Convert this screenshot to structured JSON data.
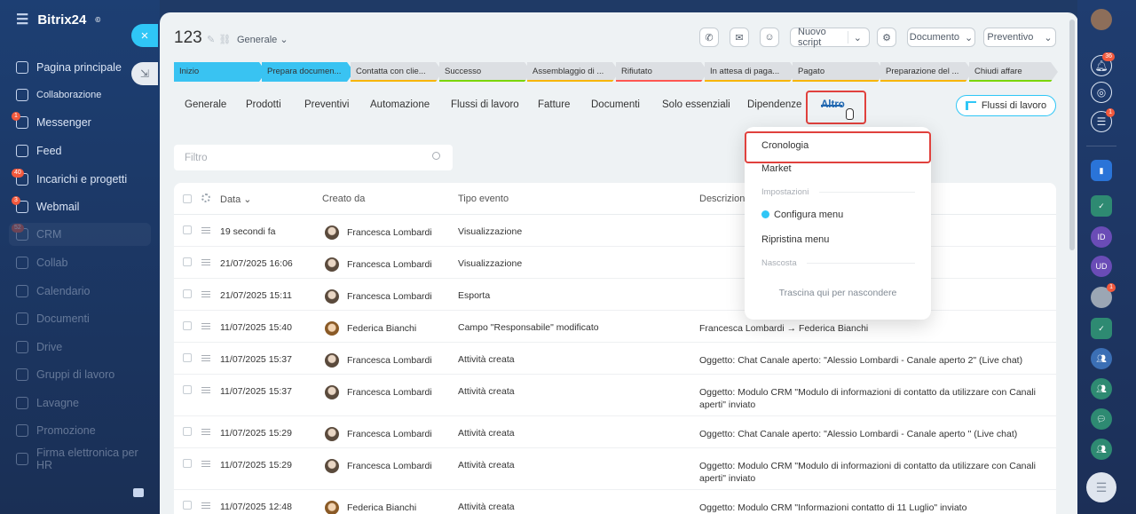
{
  "sidebar": {
    "brand": "Bitrix24",
    "brand_sup": "©",
    "items": [
      {
        "label": "Pagina principale",
        "badge": ""
      },
      {
        "label": "Collaborazione",
        "badge": ""
      },
      {
        "label": "Messenger",
        "badge": "1"
      },
      {
        "label": "Feed",
        "badge": ""
      },
      {
        "label": "Incarichi e progetti",
        "badge": "40"
      },
      {
        "label": "Webmail",
        "badge": "3"
      },
      {
        "label": "CRM",
        "badge": "52"
      },
      {
        "label": "Collab",
        "badge": ""
      },
      {
        "label": "Calendario",
        "badge": ""
      },
      {
        "label": "Documenti",
        "badge": ""
      },
      {
        "label": "Drive",
        "badge": ""
      },
      {
        "label": "Gruppi di lavoro",
        "badge": ""
      },
      {
        "label": "Lavagne",
        "badge": ""
      },
      {
        "label": "Promozione",
        "badge": ""
      },
      {
        "label": "Firma elettronica per HR",
        "badge": ""
      }
    ]
  },
  "panel": {
    "close_label": "×",
    "collapse_label": "⇲",
    "title": "123",
    "category": "Generale",
    "header_buttons": {
      "nuovo_script": "Nuovo script",
      "documento": "Documento",
      "preventivo": "Preventivo"
    },
    "stages": [
      {
        "label": "Inizio",
        "color": "#39c3f2"
      },
      {
        "label": "Prepara documen...",
        "color": "#39c3f2"
      },
      {
        "label": "Contatta con clie...",
        "color": "#dcdfe3"
      },
      {
        "label": "Successo",
        "color": "#dcdfe3"
      },
      {
        "label": "Assemblaggio di ...",
        "color": "#dcdfe3"
      },
      {
        "label": "Rifiutato",
        "color": "#dcdfe3"
      },
      {
        "label": "In attesa di paga...",
        "color": "#dcdfe3"
      },
      {
        "label": "Pagato",
        "color": "#dcdfe3"
      },
      {
        "label": "Preparazione del ...",
        "color": "#dcdfe3"
      },
      {
        "label": "Chiudi affare",
        "color": "#dcdfe3"
      }
    ],
    "tabs": [
      "Generale",
      "Prodotti",
      "Preventivi",
      "Automazione",
      "Flussi di lavoro",
      "Fatture",
      "Documenti",
      "Solo essenziali",
      "Dipendenze",
      "Altro"
    ],
    "flussi_button": "Flussi di lavoro",
    "filter_placeholder": "Filtro"
  },
  "table": {
    "columns": [
      "Data",
      "Creato da",
      "Tipo evento",
      "Descrizione"
    ],
    "rows": [
      {
        "date": "19 secondi fa",
        "author": "Francesca Lombardi",
        "type": "Visualizzazione",
        "desc": "",
        "avatar": "fl"
      },
      {
        "date": "21/07/2025 16:06",
        "author": "Francesca Lombardi",
        "type": "Visualizzazione",
        "desc": "",
        "avatar": "fl"
      },
      {
        "date": "21/07/2025 15:11",
        "author": "Francesca Lombardi",
        "type": "Esporta",
        "desc": "",
        "avatar": "fl"
      },
      {
        "date": "11/07/2025 15:40",
        "author": "Federica Bianchi",
        "type": "Campo \"Responsabile\" modificato",
        "desc": "Francesca Lombardi → Federica Bianchi",
        "avatar": "fb"
      },
      {
        "date": "11/07/2025 15:37",
        "author": "Francesca Lombardi",
        "type": "Attività creata",
        "desc": "Oggetto: Chat Canale aperto: \"Alessio Lombardi - Canale aperto 2\" (Live chat)",
        "avatar": "fl"
      },
      {
        "date": "11/07/2025 15:37",
        "author": "Francesca Lombardi",
        "type": "Attività creata",
        "desc": "Oggetto: Modulo CRM \"Modulo di informazioni di contatto da utilizzare con Canali aperti\" inviato",
        "avatar": "fl"
      },
      {
        "date": "11/07/2025 15:29",
        "author": "Francesca Lombardi",
        "type": "Attività creata",
        "desc": "Oggetto: Chat Canale aperto: \"Alessio Lombardi - Canale aperto \" (Live chat)",
        "avatar": "fl"
      },
      {
        "date": "11/07/2025 15:29",
        "author": "Francesca Lombardi",
        "type": "Attività creata",
        "desc": "Oggetto: Modulo CRM \"Modulo di informazioni di contatto da utilizzare con Canali aperti\" inviato",
        "avatar": "fl"
      },
      {
        "date": "11/07/2025 12:48",
        "author": "Federica Bianchi",
        "type": "Attività creata",
        "desc": "Oggetto: Modulo CRM \"Informazioni contatto di 11 Luglio\" inviato",
        "avatar": "fb"
      }
    ]
  },
  "dropdown": {
    "items": [
      "Cronologia",
      "Market"
    ],
    "section_settings": "Impostazioni",
    "configure": "Configura menu",
    "reset": "Ripristina menu",
    "section_hidden": "Nascosta",
    "drag_hint": "Trascina qui per nascondere"
  },
  "right_bar": {
    "badges": [
      "36",
      "1",
      "1"
    ],
    "apps": [
      "ID",
      "UD"
    ]
  }
}
